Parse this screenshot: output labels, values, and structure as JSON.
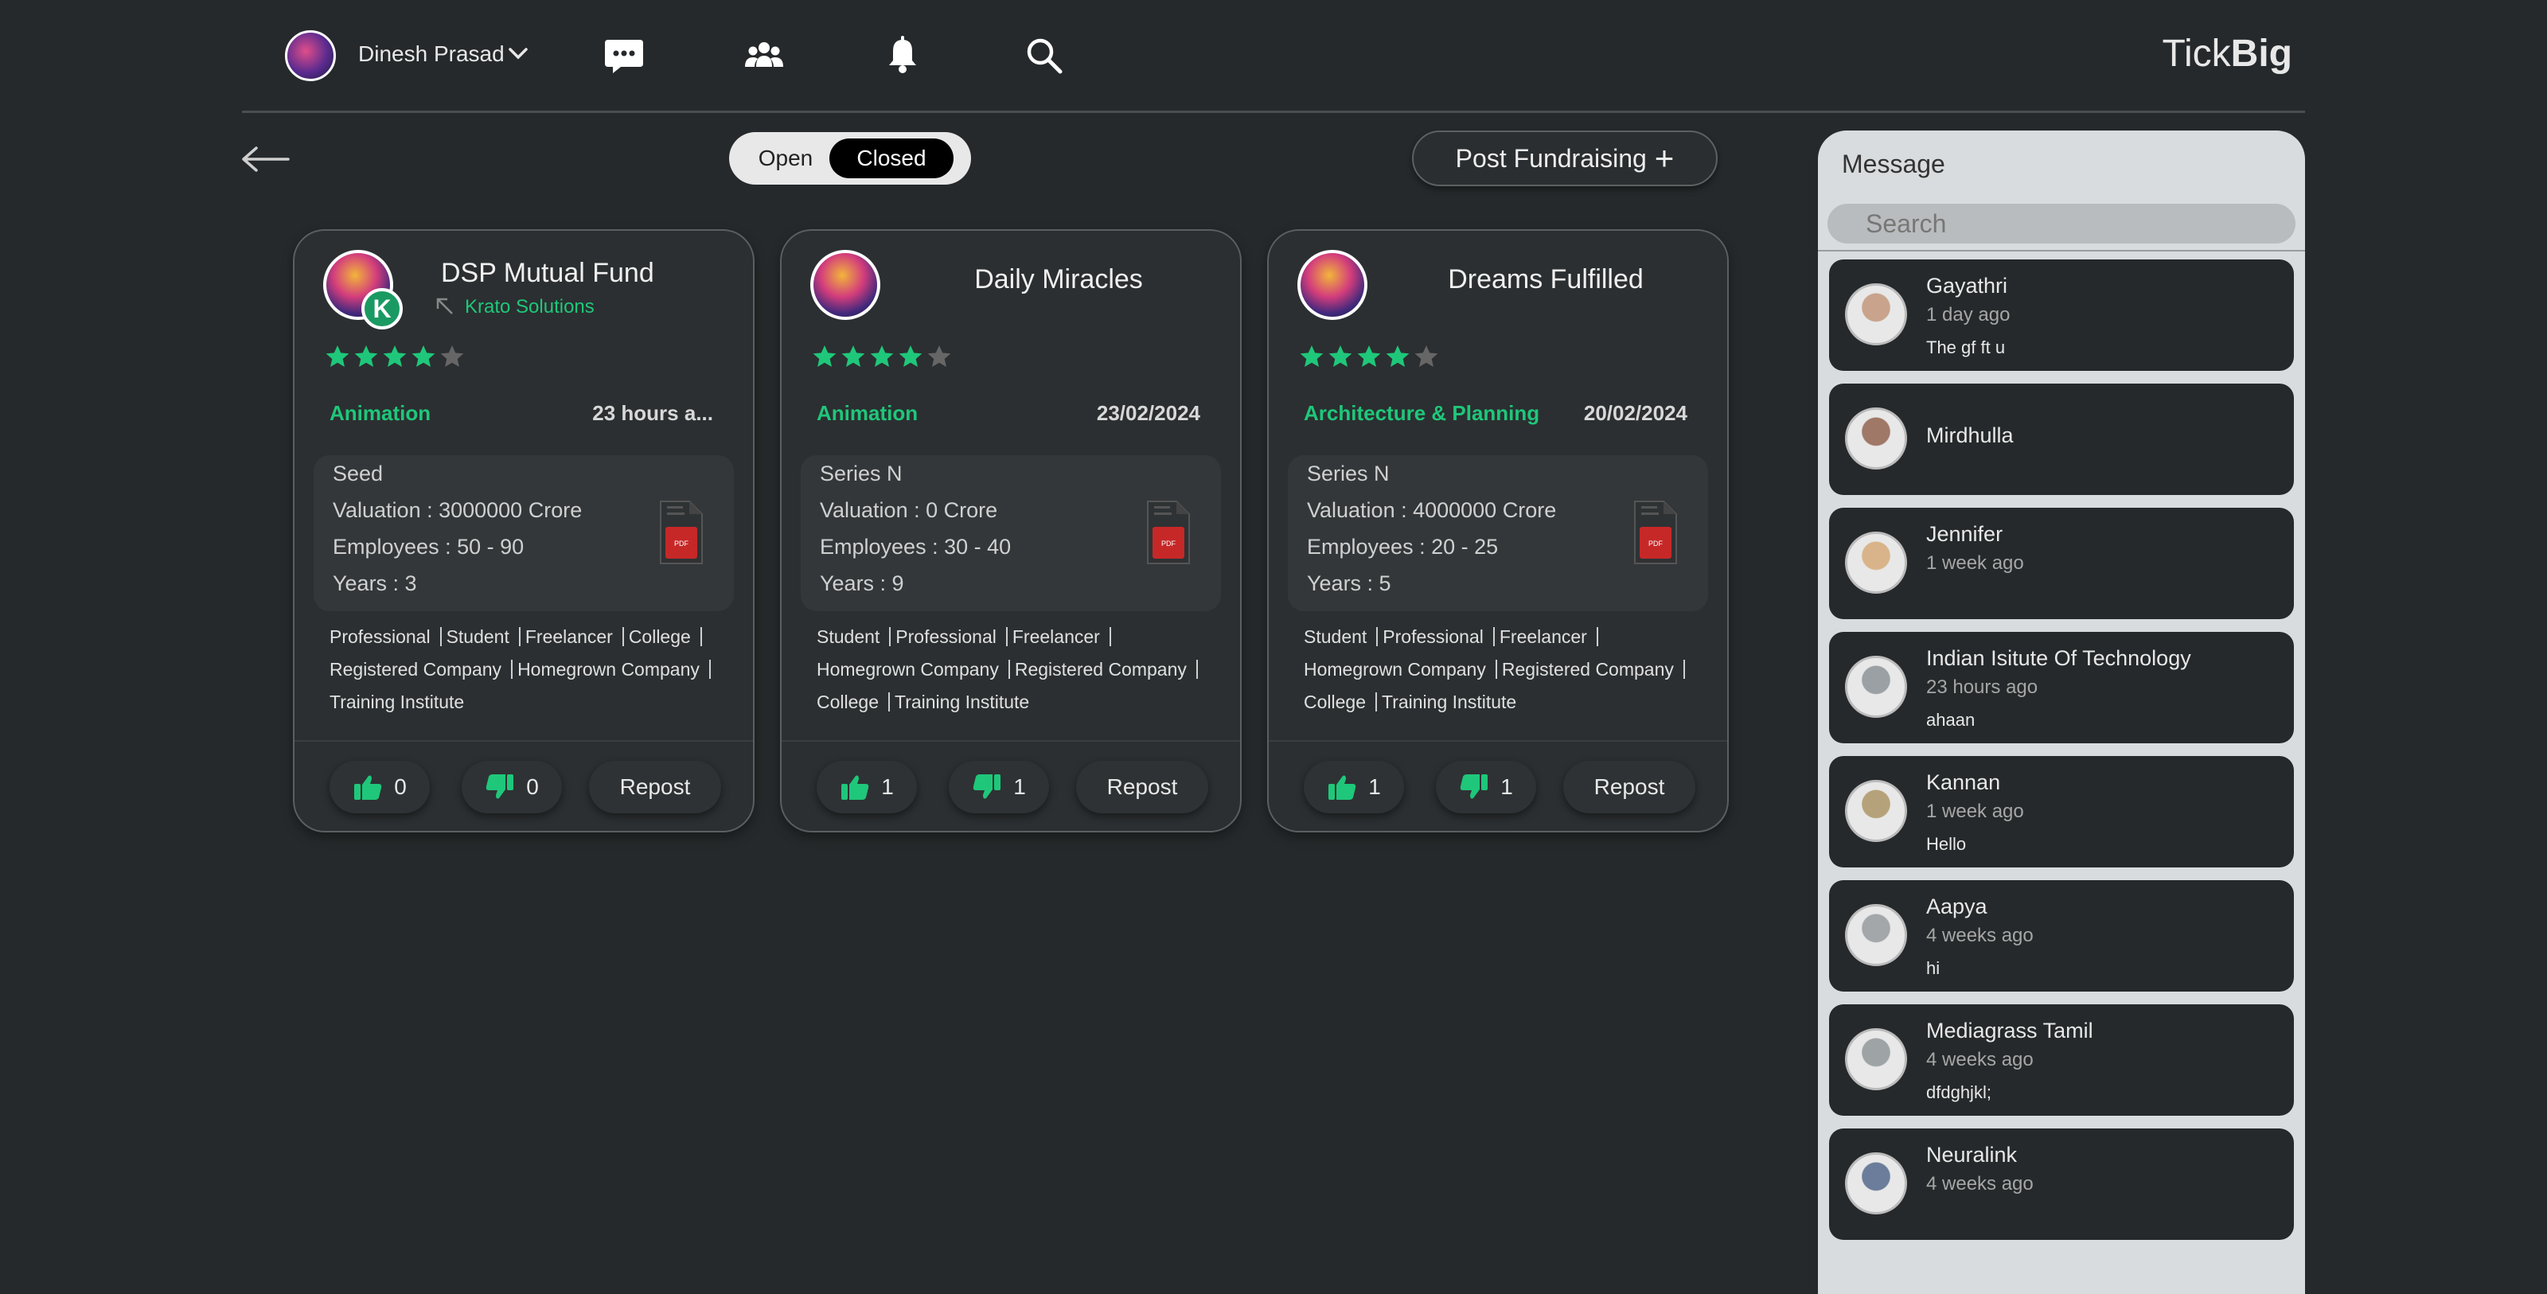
{
  "header": {
    "user_name": "Dinesh Prasad",
    "brand_light": "Tick",
    "brand_bold": "Big",
    "icons": [
      "chat-icon",
      "community-icon",
      "bell-icon",
      "search-icon"
    ]
  },
  "toolbar": {
    "toggle_open": "Open",
    "toggle_closed": "Closed",
    "selected": "Closed",
    "post_label": "Post Fundraising",
    "post_icon": "+"
  },
  "cards": [
    {
      "title": "DSP Mutual Fund",
      "company": "Krato Solutions",
      "rating": 4,
      "category": "Animation",
      "date": "23 hours a...",
      "stage": "Seed",
      "valuation": "Valuation : 3000000 Crore",
      "employees": "Employees : 50 - 90",
      "years": "Years : 3",
      "tags": [
        "Professional",
        "Student",
        "Freelancer",
        "College",
        "Registered Company",
        "Homegrown Company",
        "Training Institute"
      ],
      "likes": "0",
      "dislikes": "0",
      "repost": "Repost"
    },
    {
      "title": "Daily Miracles",
      "company": "",
      "rating": 4,
      "category": "Animation",
      "date": "23/02/2024",
      "stage": "Series N",
      "valuation": "Valuation : 0 Crore",
      "employees": "Employees : 30 - 40",
      "years": "Years : 9",
      "tags": [
        "Student",
        "Professional",
        "Freelancer",
        "Homegrown Company",
        "Registered Company",
        "College",
        "Training Institute"
      ],
      "likes": "1",
      "dislikes": "1",
      "repost": "Repost"
    },
    {
      "title": "Dreams Fulfilled",
      "company": "",
      "rating": 4,
      "category": "Architecture & Planning",
      "date": "20/02/2024",
      "stage": "Series N",
      "valuation": "Valuation : 4000000 Crore",
      "employees": "Employees : 20 - 25",
      "years": "Years : 5",
      "tags": [
        "Student",
        "Professional",
        "Freelancer",
        "Homegrown Company",
        "Registered Company",
        "College",
        "Training Institute"
      ],
      "likes": "1",
      "dislikes": "1",
      "repost": "Repost"
    }
  ],
  "messages": {
    "title": "Message",
    "search_placeholder": "Search",
    "items": [
      {
        "name": "Gayathri",
        "time": "1 day ago",
        "text": "The gf ft u"
      },
      {
        "name": "Mirdhulla",
        "time": "",
        "text": ""
      },
      {
        "name": "Jennifer",
        "time": "1 week ago",
        "text": ""
      },
      {
        "name": "Indian Isitute Of Technology",
        "time": "23 hours ago",
        "text": "ahaan"
      },
      {
        "name": "Kannan",
        "time": "1 week ago",
        "text": "Hello"
      },
      {
        "name": "Aapya",
        "time": "4 weeks ago",
        "text": "hi"
      },
      {
        "name": "Mediagrass Tamil",
        "time": "4 weeks ago",
        "text": "dfdghjkl;"
      },
      {
        "name": "Neuralink",
        "time": "4 weeks ago",
        "text": ""
      }
    ]
  },
  "colors": {
    "background": "#25292b",
    "accent_green": "#1fc77a",
    "panel": "#d9dcde"
  }
}
